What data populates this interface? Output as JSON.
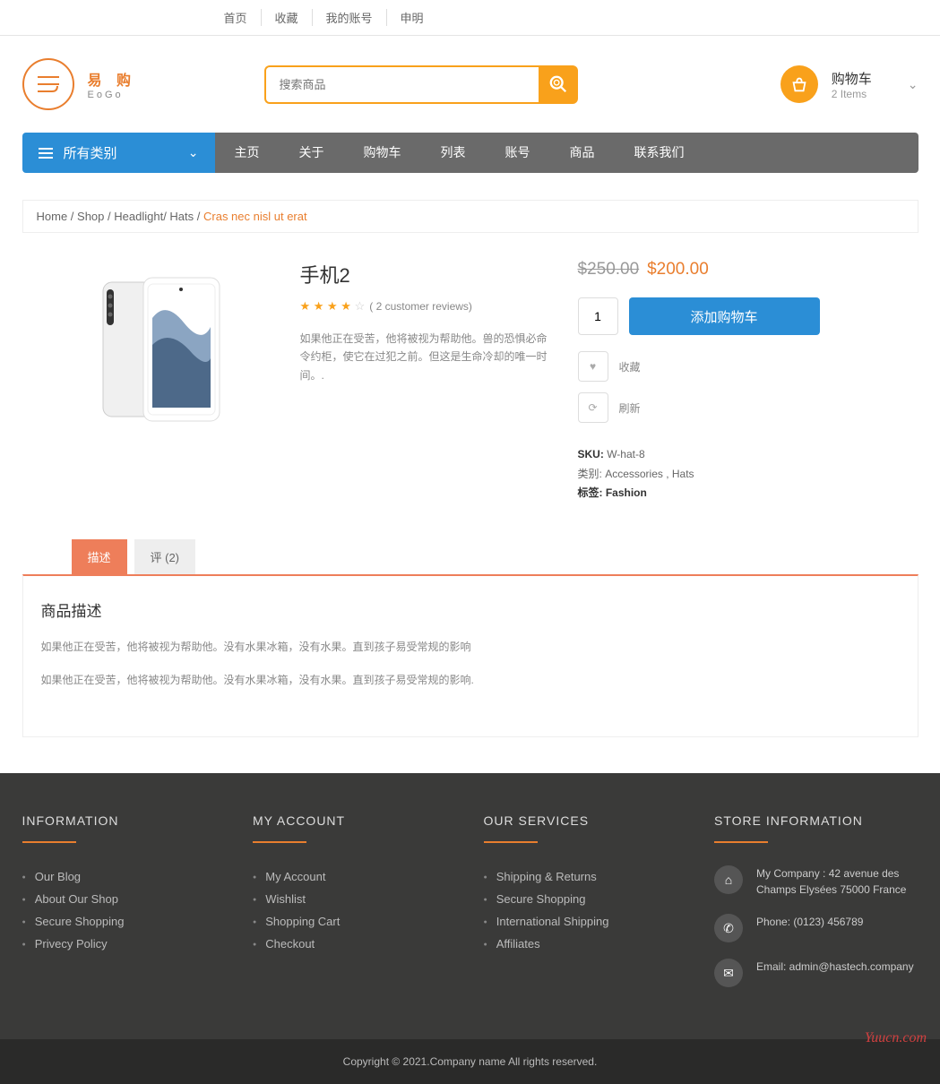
{
  "top_links": [
    "首页",
    "收藏",
    "我的账号",
    "申明"
  ],
  "logo": {
    "cn": "易 购",
    "en": "EoGo"
  },
  "search": {
    "placeholder": "搜索商品"
  },
  "cart": {
    "title": "购物车",
    "count": "2 Items"
  },
  "categories_label": "所有类别",
  "nav": [
    "主页",
    "关于",
    "购物车",
    "列表",
    "账号",
    "商品",
    "联系我们"
  ],
  "breadcrumb": {
    "items": [
      "Home",
      "Shop",
      "Headlight",
      "Hats"
    ],
    "active": "Cras nec nisl ut erat"
  },
  "product": {
    "title": "手机2",
    "reviews": "( 2 customer reviews)",
    "desc": "如果他正在受苦，他将被视为帮助他。兽的恐惧必命令约柜，使它在过犯之前。但这是生命冷却的唯一时间。.",
    "old_price": "$250.00",
    "new_price": "$200.00",
    "qty": "1",
    "add_cart": "添加购物车",
    "wishlist": "收藏",
    "refresh": "刷新",
    "sku_label": "SKU:",
    "sku_value": "W-hat-8",
    "cat_label": "类别:",
    "cat_value": "Accessories , Hats",
    "tag_label": "标签:",
    "tag_value": "Fashion"
  },
  "tabs": {
    "desc": "描述",
    "reviews": "评 (2)"
  },
  "tab_content": {
    "title": "商品描述",
    "p1": "如果他正在受苦，他将被视为帮助他。没有水果冰箱，没有水果。直到孩子易受常规的影响",
    "p2": "如果他正在受苦，他将被视为帮助他。没有水果冰箱，没有水果。直到孩子易受常规的影响."
  },
  "footer": {
    "info": {
      "title": "INFORMATION",
      "items": [
        "Our Blog",
        "About Our Shop",
        "Secure Shopping",
        "Privecy Policy"
      ]
    },
    "account": {
      "title": "MY ACCOUNT",
      "items": [
        "My Account",
        "Wishlist",
        "Shopping Cart",
        "Checkout"
      ]
    },
    "services": {
      "title": "OUR SERVICES",
      "items": [
        "Shipping & Returns",
        "Secure Shopping",
        "International Shipping",
        "Affiliates"
      ]
    },
    "store": {
      "title": "STORE INFORMATION",
      "address": "My Company : 42 avenue des Champs Elysées 75000 France",
      "phone": "Phone: (0123) 456789",
      "email": "Email: admin@hastech.company"
    }
  },
  "copyright": "Copyright © 2021.Company name All rights reserved.",
  "watermark": "Yuucn.com"
}
